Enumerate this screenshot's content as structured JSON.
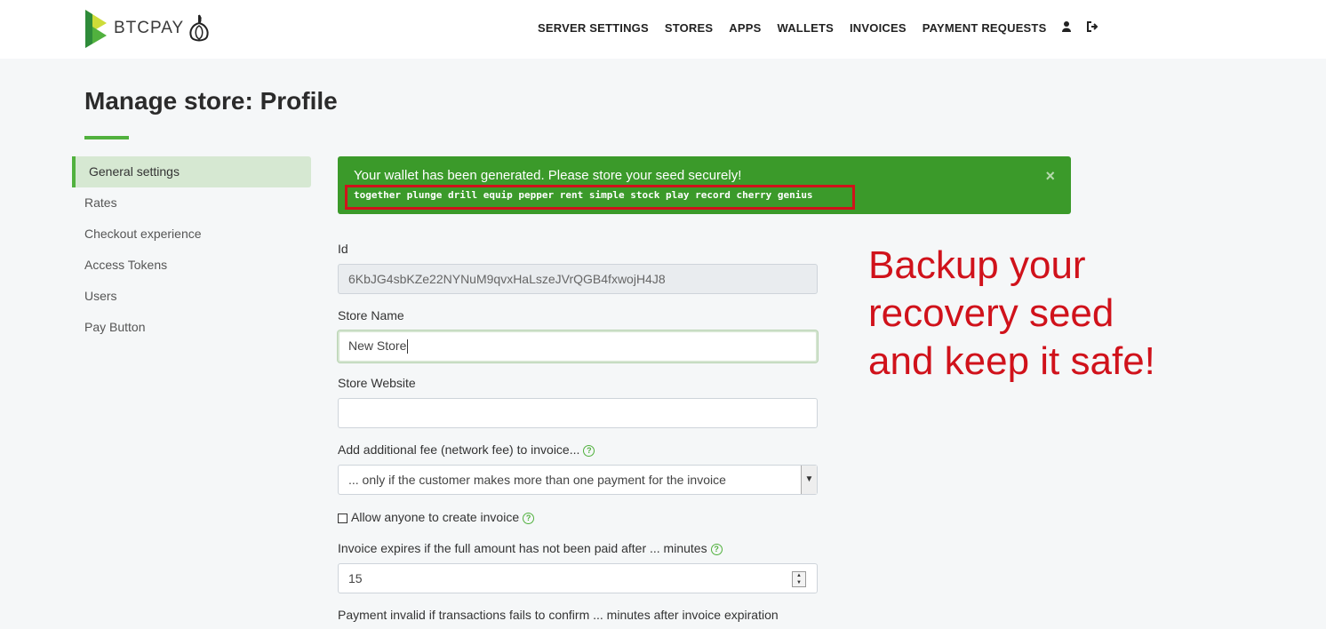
{
  "header": {
    "brand": "BTCPAY",
    "nav": [
      "SERVER SETTINGS",
      "STORES",
      "APPS",
      "WALLETS",
      "INVOICES",
      "PAYMENT REQUESTS"
    ],
    "icons": [
      "user-icon",
      "logout-icon"
    ]
  },
  "page": {
    "title": "Manage store: Profile"
  },
  "sidebar": {
    "items": [
      {
        "label": "General settings",
        "active": true
      },
      {
        "label": "Rates"
      },
      {
        "label": "Checkout experience"
      },
      {
        "label": "Access Tokens"
      },
      {
        "label": "Users"
      },
      {
        "label": "Pay Button"
      }
    ]
  },
  "alert": {
    "message": "Your wallet has been generated. Please store your seed securely!",
    "seed": "together plunge drill equip pepper rent simple stock play record cherry genius",
    "close": "×"
  },
  "form": {
    "id_label": "Id",
    "id_value": "6KbJG4sbKZe22NYNuM9qvxHaLszeJVrQGB4fxwojH4J8",
    "store_name_label": "Store Name",
    "store_name_value": "New Store",
    "store_website_label": "Store Website",
    "store_website_value": "",
    "fee_label": "Add additional fee (network fee) to invoice...",
    "fee_selected": "... only if the customer makes more than one payment for the invoice",
    "allow_anyone_label": "Allow anyone to create invoice",
    "allow_anyone_checked": false,
    "expire_label": "Invoice expires if the full amount has not been paid after ... minutes",
    "expire_value": "15",
    "payment_invalid_label": "Payment invalid if transactions fails to confirm ... minutes after invoice expiration"
  },
  "annotation": {
    "line1": "Backup your",
    "line2": "recovery seed",
    "line3": "and keep it safe!"
  },
  "colors": {
    "brand_green": "#51b13e",
    "alert_green": "#3b9a2a",
    "annotation_red": "#d0121b"
  }
}
